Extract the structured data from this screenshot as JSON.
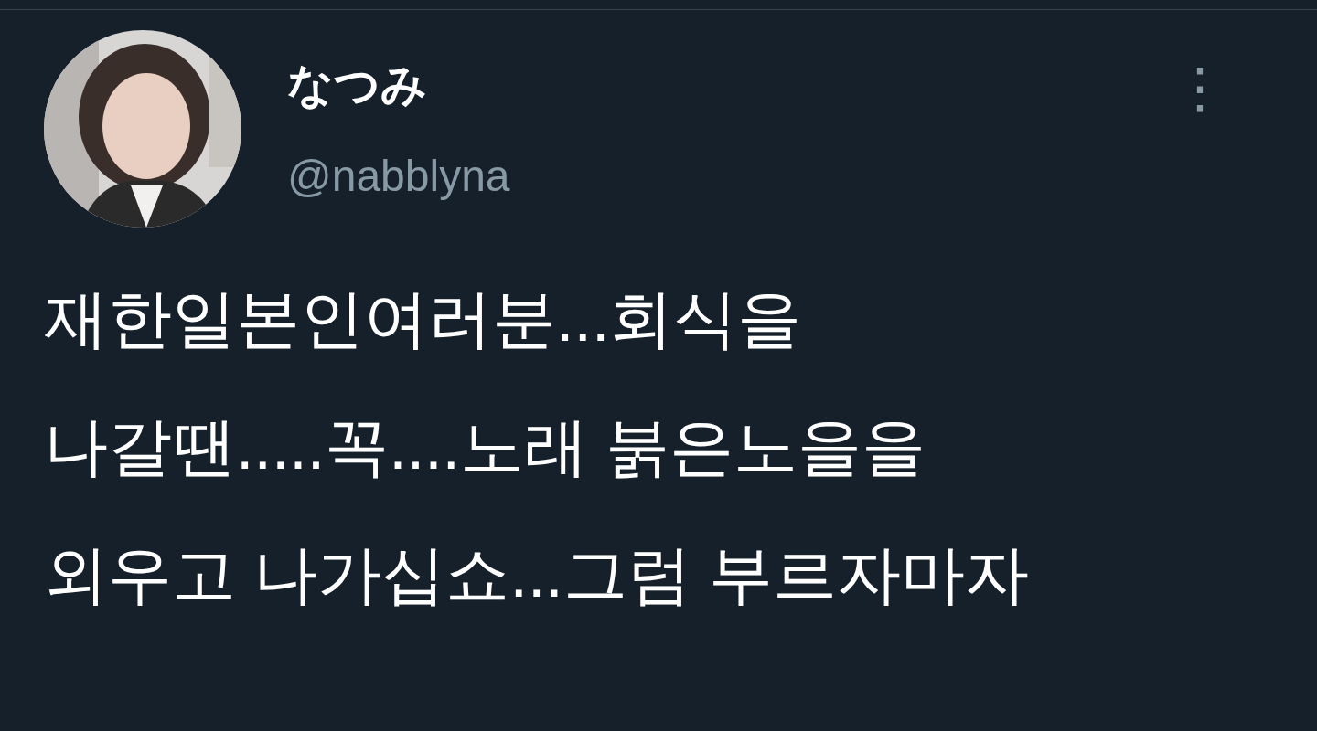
{
  "tweet": {
    "display_name": "なつみ",
    "handle": "@nabblyna",
    "more_menu": "⋮",
    "text": "재한일본인여러분...회식을\n나갈땐.....꼭....노래 붉은노을을\n외우고 나가십쇼...그럼 부르자마자"
  }
}
